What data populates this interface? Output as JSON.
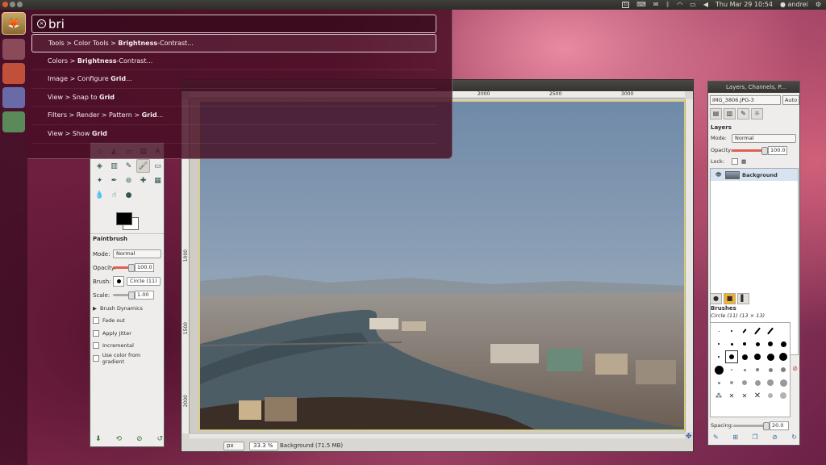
{
  "top_panel": {
    "datetime": "Thu Mar 29 10:54",
    "user": "andrei"
  },
  "hud": {
    "query": "bri",
    "results": [
      {
        "prefix": "Tools > Color Tools > ",
        "match": "Brightness",
        "suffix": "-Contrast..."
      },
      {
        "prefix": "Colors > ",
        "match": "Brightness",
        "suffix": "-Contrast..."
      },
      {
        "prefix": "Image > Configure ",
        "match": "Grid",
        "suffix": "..."
      },
      {
        "prefix": "View > Snap to ",
        "match": "Grid",
        "suffix": ""
      },
      {
        "prefix": "Filters > Render > Pattern > ",
        "match": "Grid",
        "suffix": "..."
      },
      {
        "prefix": "View > Show ",
        "match": "Grid",
        "suffix": ""
      }
    ]
  },
  "image_window": {
    "ruler_h": [
      "2000",
      "2500",
      "3000"
    ],
    "ruler_v": [
      "1000",
      "1500",
      "2000"
    ],
    "status_units": "px",
    "status_zoom": "33.3 %",
    "status_layer": "Background (71.5 MB)"
  },
  "toolbox": {
    "title": "Paintbrush",
    "mode_label": "Mode:",
    "mode_value": "Normal",
    "opacity_label": "Opacity:",
    "opacity_value": "100.0",
    "brush_label": "Brush:",
    "brush_value": "Circle (11)",
    "scale_label": "Scale:",
    "scale_value": "1.00",
    "brush_dynamics": "Brush Dynamics",
    "options": [
      "Fade out",
      "Apply Jitter",
      "Incremental",
      "Use color from gradient"
    ]
  },
  "dock": {
    "title": "Layers, Channels, P...",
    "image_combo": "IMG_3806.JPG-3",
    "auto_label": "Auto",
    "layers_title": "Layers",
    "mode_label": "Mode:",
    "mode_value": "Normal",
    "opacity_label": "Opacity:",
    "opacity_value": "100.0",
    "lock_label": "Lock:",
    "layer_name": "Background",
    "brushes_title": "Brushes",
    "brush_info": "Circle (11) (13 × 13)",
    "spacing_label": "Spacing:",
    "spacing_value": "20.0"
  }
}
